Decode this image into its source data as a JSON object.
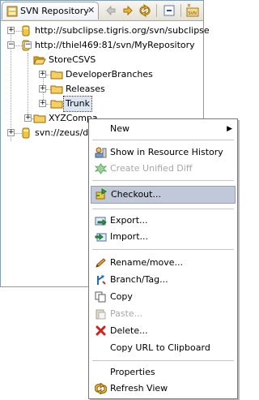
{
  "view": {
    "tab_title": "SVN Repository",
    "close_glyph": "✕"
  },
  "tree": [
    {
      "label": "http://subclipse.tigris.org/svn/subclipse",
      "expander": "+",
      "icon": "repository-icon"
    },
    {
      "label": "http://thiel469:81/svn/MyRepository",
      "expander": "−",
      "icon": "repository-icon"
    },
    {
      "label": "StoreCSVS",
      "expander": "−",
      "icon": "folder-open-icon"
    },
    {
      "label": "DeveloperBranches",
      "expander": "+",
      "icon": "folder-icon"
    },
    {
      "label": "Releases",
      "expander": "+",
      "icon": "folder-icon"
    },
    {
      "label": "Trunk",
      "expander": "+",
      "icon": "folder-icon"
    },
    {
      "label": "XYZCompa",
      "expander": "+",
      "icon": "folder-icon"
    },
    {
      "label": "svn://zeus/de",
      "expander": "+",
      "icon": "repository-icon"
    }
  ],
  "menu": {
    "items": [
      {
        "label": "New",
        "submenu_glyph": "▶"
      },
      {
        "label": "Show in Resource History"
      },
      {
        "label": "Create Unified Diff"
      },
      {
        "label": "Checkout..."
      },
      {
        "label": "Export..."
      },
      {
        "label": "Import..."
      },
      {
        "label": "Rename/move..."
      },
      {
        "label": "Branch/Tag..."
      },
      {
        "label": "Copy"
      },
      {
        "label": "Paste..."
      },
      {
        "label": "Delete..."
      },
      {
        "label": "Copy URL to Clipboard"
      },
      {
        "label": "Properties"
      },
      {
        "label": "Refresh View"
      }
    ]
  },
  "colors": {
    "menu_highlight": "#c1c8d8",
    "disabled_text": "#a7a6aa",
    "folder": "#f2c45a",
    "repository": "#d8a825"
  }
}
